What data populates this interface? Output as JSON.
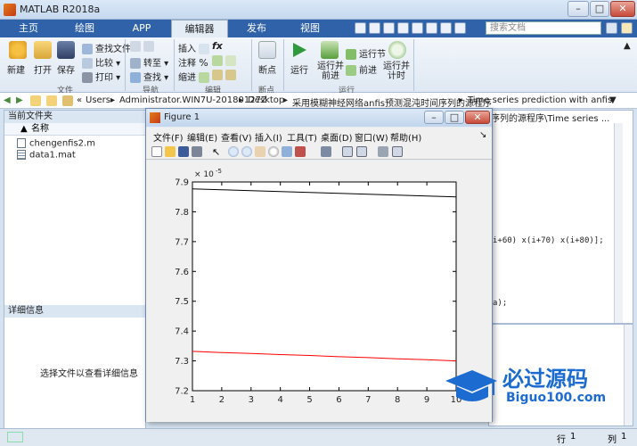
{
  "window": {
    "title": "MATLAB R2018a",
    "minimize": "–",
    "maximize": "□",
    "close": "✕"
  },
  "tabs": [
    {
      "label": "主页"
    },
    {
      "label": "绘图"
    },
    {
      "label": "APP"
    },
    {
      "label": "编辑器"
    },
    {
      "label": "发布"
    },
    {
      "label": "视图"
    }
  ],
  "search": {
    "placeholder": "搜索文档"
  },
  "ribbon": {
    "file": {
      "new": "新建",
      "open": "打开",
      "save": "保存",
      "find_files": "查找文件",
      "compare": "比较",
      "print": "打印",
      "group": "文件"
    },
    "navigate": {
      "goto": "转至",
      "find": "查找",
      "group": "导航"
    },
    "edit": {
      "insert": "插入",
      "comment": "注释",
      "indent": "缩进",
      "fx": "fx",
      "group": "编辑"
    },
    "breakpoints": {
      "label": "断点",
      "group": "断点"
    },
    "run": {
      "run": "运行",
      "run_advance": "运行并\n前进",
      "run_section": "运行节",
      "advance": "前进",
      "run_time": "运行并\n计时",
      "group": "运行"
    }
  },
  "address": {
    "crumbs": [
      "«",
      "Users",
      "▸",
      "Administrator.WIN7U-20180127Z",
      "▸",
      "Desktop",
      "▸",
      "采用模糊神经网络anfis预测混沌时间序列的源程序",
      "▸",
      "Time series prediction with anfis"
    ]
  },
  "current_folder": {
    "title": "当前文件夹",
    "column": "名称",
    "column_sort": "▲",
    "files": [
      {
        "name": "chengenfis2.m",
        "type": "m"
      },
      {
        "name": "data1.mat",
        "type": "mat"
      }
    ],
    "details_title": "详细信息",
    "details_hint": "选择文件以查看详细信息"
  },
  "editor": {
    "path_fragment": "时间序列的源程序\\Time series ...",
    "code_line_1": "i+60) x(i+70) x(i+80)];",
    "code_line_2": "a);"
  },
  "statusbar": {
    "line_label": "行",
    "line_value": "1",
    "col_label": "列",
    "col_value": "1"
  },
  "figure": {
    "title": "Figure 1",
    "menu": [
      "文件(F)",
      "编辑(E)",
      "查看(V)",
      "插入(I)",
      "工具(T)",
      "桌面(D)",
      "窗口(W)",
      "帮助(H)"
    ],
    "menu_arrow": "↘"
  },
  "colors": {
    "ribbon_tab_bar": "#2f62a8",
    "series_black": "#000000",
    "series_red": "#ff0000"
  },
  "chart_data": {
    "type": "line",
    "x": [
      1,
      2,
      3,
      4,
      5,
      6,
      7,
      8,
      9,
      10
    ],
    "series": [
      {
        "color": "#000000",
        "values": [
          7.877,
          7.874,
          7.871,
          7.868,
          7.865,
          7.862,
          7.859,
          7.856,
          7.853,
          7.85
        ]
      },
      {
        "color": "#ff0000",
        "values": [
          7.332,
          7.328,
          7.325,
          7.321,
          7.318,
          7.314,
          7.311,
          7.307,
          7.304,
          7.3
        ]
      }
    ],
    "xlim": [
      1,
      10
    ],
    "ylim": [
      7.2,
      7.9
    ],
    "xticks": [
      "1",
      "2",
      "3",
      "4",
      "5",
      "6",
      "7",
      "8",
      "9",
      "10"
    ],
    "yticks": [
      "7.2",
      "7.3",
      "7.4",
      "7.5",
      "7.6",
      "7.7",
      "7.8",
      "7.9"
    ],
    "y_exponent": "× 10",
    "y_exponent_power": "-5",
    "title": "",
    "xlabel": "",
    "ylabel": "",
    "grid": false
  },
  "watermark": {
    "text": "必过源码",
    "url": "Biguo100.com"
  }
}
